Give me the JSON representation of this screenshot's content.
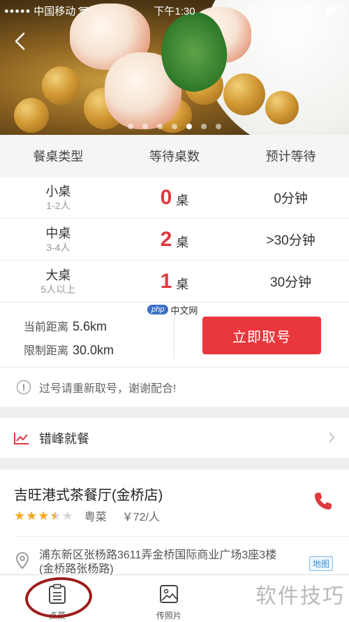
{
  "status_bar": {
    "signal_dots": "●●●●●",
    "carrier": "中国移动",
    "time": "下午1:30",
    "battery_text": "48%",
    "battery_level": 0.48
  },
  "hero": {
    "pager_count": 7,
    "pager_active": 4
  },
  "queue": {
    "headers": [
      "餐桌类型",
      "等待桌数",
      "预计等待"
    ],
    "rows": [
      {
        "type": "小桌",
        "capacity": "1-2人",
        "count": "0",
        "unit": "桌",
        "wait": "0分钟"
      },
      {
        "type": "中桌",
        "capacity": "3-4人",
        "count": "2",
        "unit": "桌",
        "wait": ">30分钟"
      },
      {
        "type": "大桌",
        "capacity": "5人以上",
        "count": "1",
        "unit": "桌",
        "wait": "30分钟"
      }
    ],
    "current_distance_label": "当前距离",
    "current_distance_value": "5.6km",
    "limit_distance_label": "限制距离",
    "limit_distance_value": "30.0km",
    "take_number_button": "立即取号",
    "notice": "过号请重新取号，谢谢配合!",
    "notice_icon": "!"
  },
  "offpeak": {
    "label": "错峰就餐"
  },
  "restaurant": {
    "name": "吉旺港式茶餐厅(金桥店)",
    "rating": 3.5,
    "cuisine": "粤菜",
    "price": "￥72/人",
    "address": "浦东新区张杨路3611弄金桥国际商业广场3座3楼(金桥路张杨路)",
    "map_label": "地图"
  },
  "tabbar": {
    "order_label": "点菜",
    "photo_label": "传照片"
  },
  "watermarks": {
    "php_logo": "php",
    "php_text": "中文网",
    "tips_text": "软件技巧"
  },
  "colors": {
    "accent_red": "#e8383d",
    "count_red": "#e0393e",
    "star": "#f5a623",
    "map_blue": "#3a8fd6",
    "annotation_circle": "#9e1c1c"
  }
}
